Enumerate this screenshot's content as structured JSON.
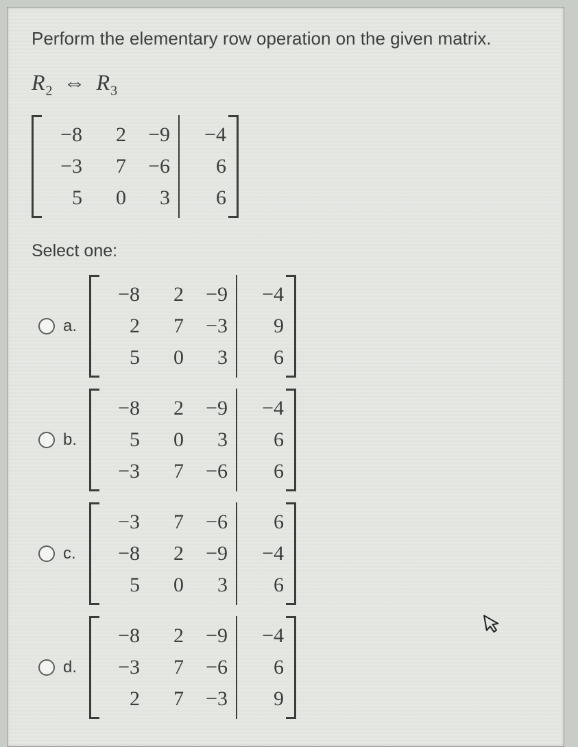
{
  "prompt": "Perform the elementary row operation on the given matrix.",
  "operation": {
    "left": "R",
    "lsub": "2",
    "arrow": "⇔",
    "right": "R",
    "rsub": "3"
  },
  "matrix": {
    "r1": {
      "c1": "−8",
      "c2": "2",
      "c3": "−9",
      "c4": "−4"
    },
    "r2": {
      "c1": "−3",
      "c2": "7",
      "c3": "−6",
      "c4": "6"
    },
    "r3": {
      "c1": "5",
      "c2": "0",
      "c3": "3",
      "c4": "6"
    }
  },
  "selectOne": "Select one:",
  "options": {
    "a": {
      "label": "a.",
      "r1": {
        "c1": "−8",
        "c2": "2",
        "c3": "−9",
        "c4": "−4"
      },
      "r2": {
        "c1": "2",
        "c2": "7",
        "c3": "−3",
        "c4": "9"
      },
      "r3": {
        "c1": "5",
        "c2": "0",
        "c3": "3",
        "c4": "6"
      }
    },
    "b": {
      "label": "b.",
      "r1": {
        "c1": "−8",
        "c2": "2",
        "c3": "−9",
        "c4": "−4"
      },
      "r2": {
        "c1": "5",
        "c2": "0",
        "c3": "3",
        "c4": "6"
      },
      "r3": {
        "c1": "−3",
        "c2": "7",
        "c3": "−6",
        "c4": "6"
      }
    },
    "c": {
      "label": "c.",
      "r1": {
        "c1": "−3",
        "c2": "7",
        "c3": "−6",
        "c4": "6"
      },
      "r2": {
        "c1": "−8",
        "c2": "2",
        "c3": "−9",
        "c4": "−4"
      },
      "r3": {
        "c1": "5",
        "c2": "0",
        "c3": "3",
        "c4": "6"
      }
    },
    "d": {
      "label": "d.",
      "r1": {
        "c1": "−8",
        "c2": "2",
        "c3": "−9",
        "c4": "−4"
      },
      "r2": {
        "c1": "−3",
        "c2": "7",
        "c3": "−6",
        "c4": "6"
      },
      "r3": {
        "c1": "2",
        "c2": "7",
        "c3": "−3",
        "c4": "9"
      }
    }
  }
}
